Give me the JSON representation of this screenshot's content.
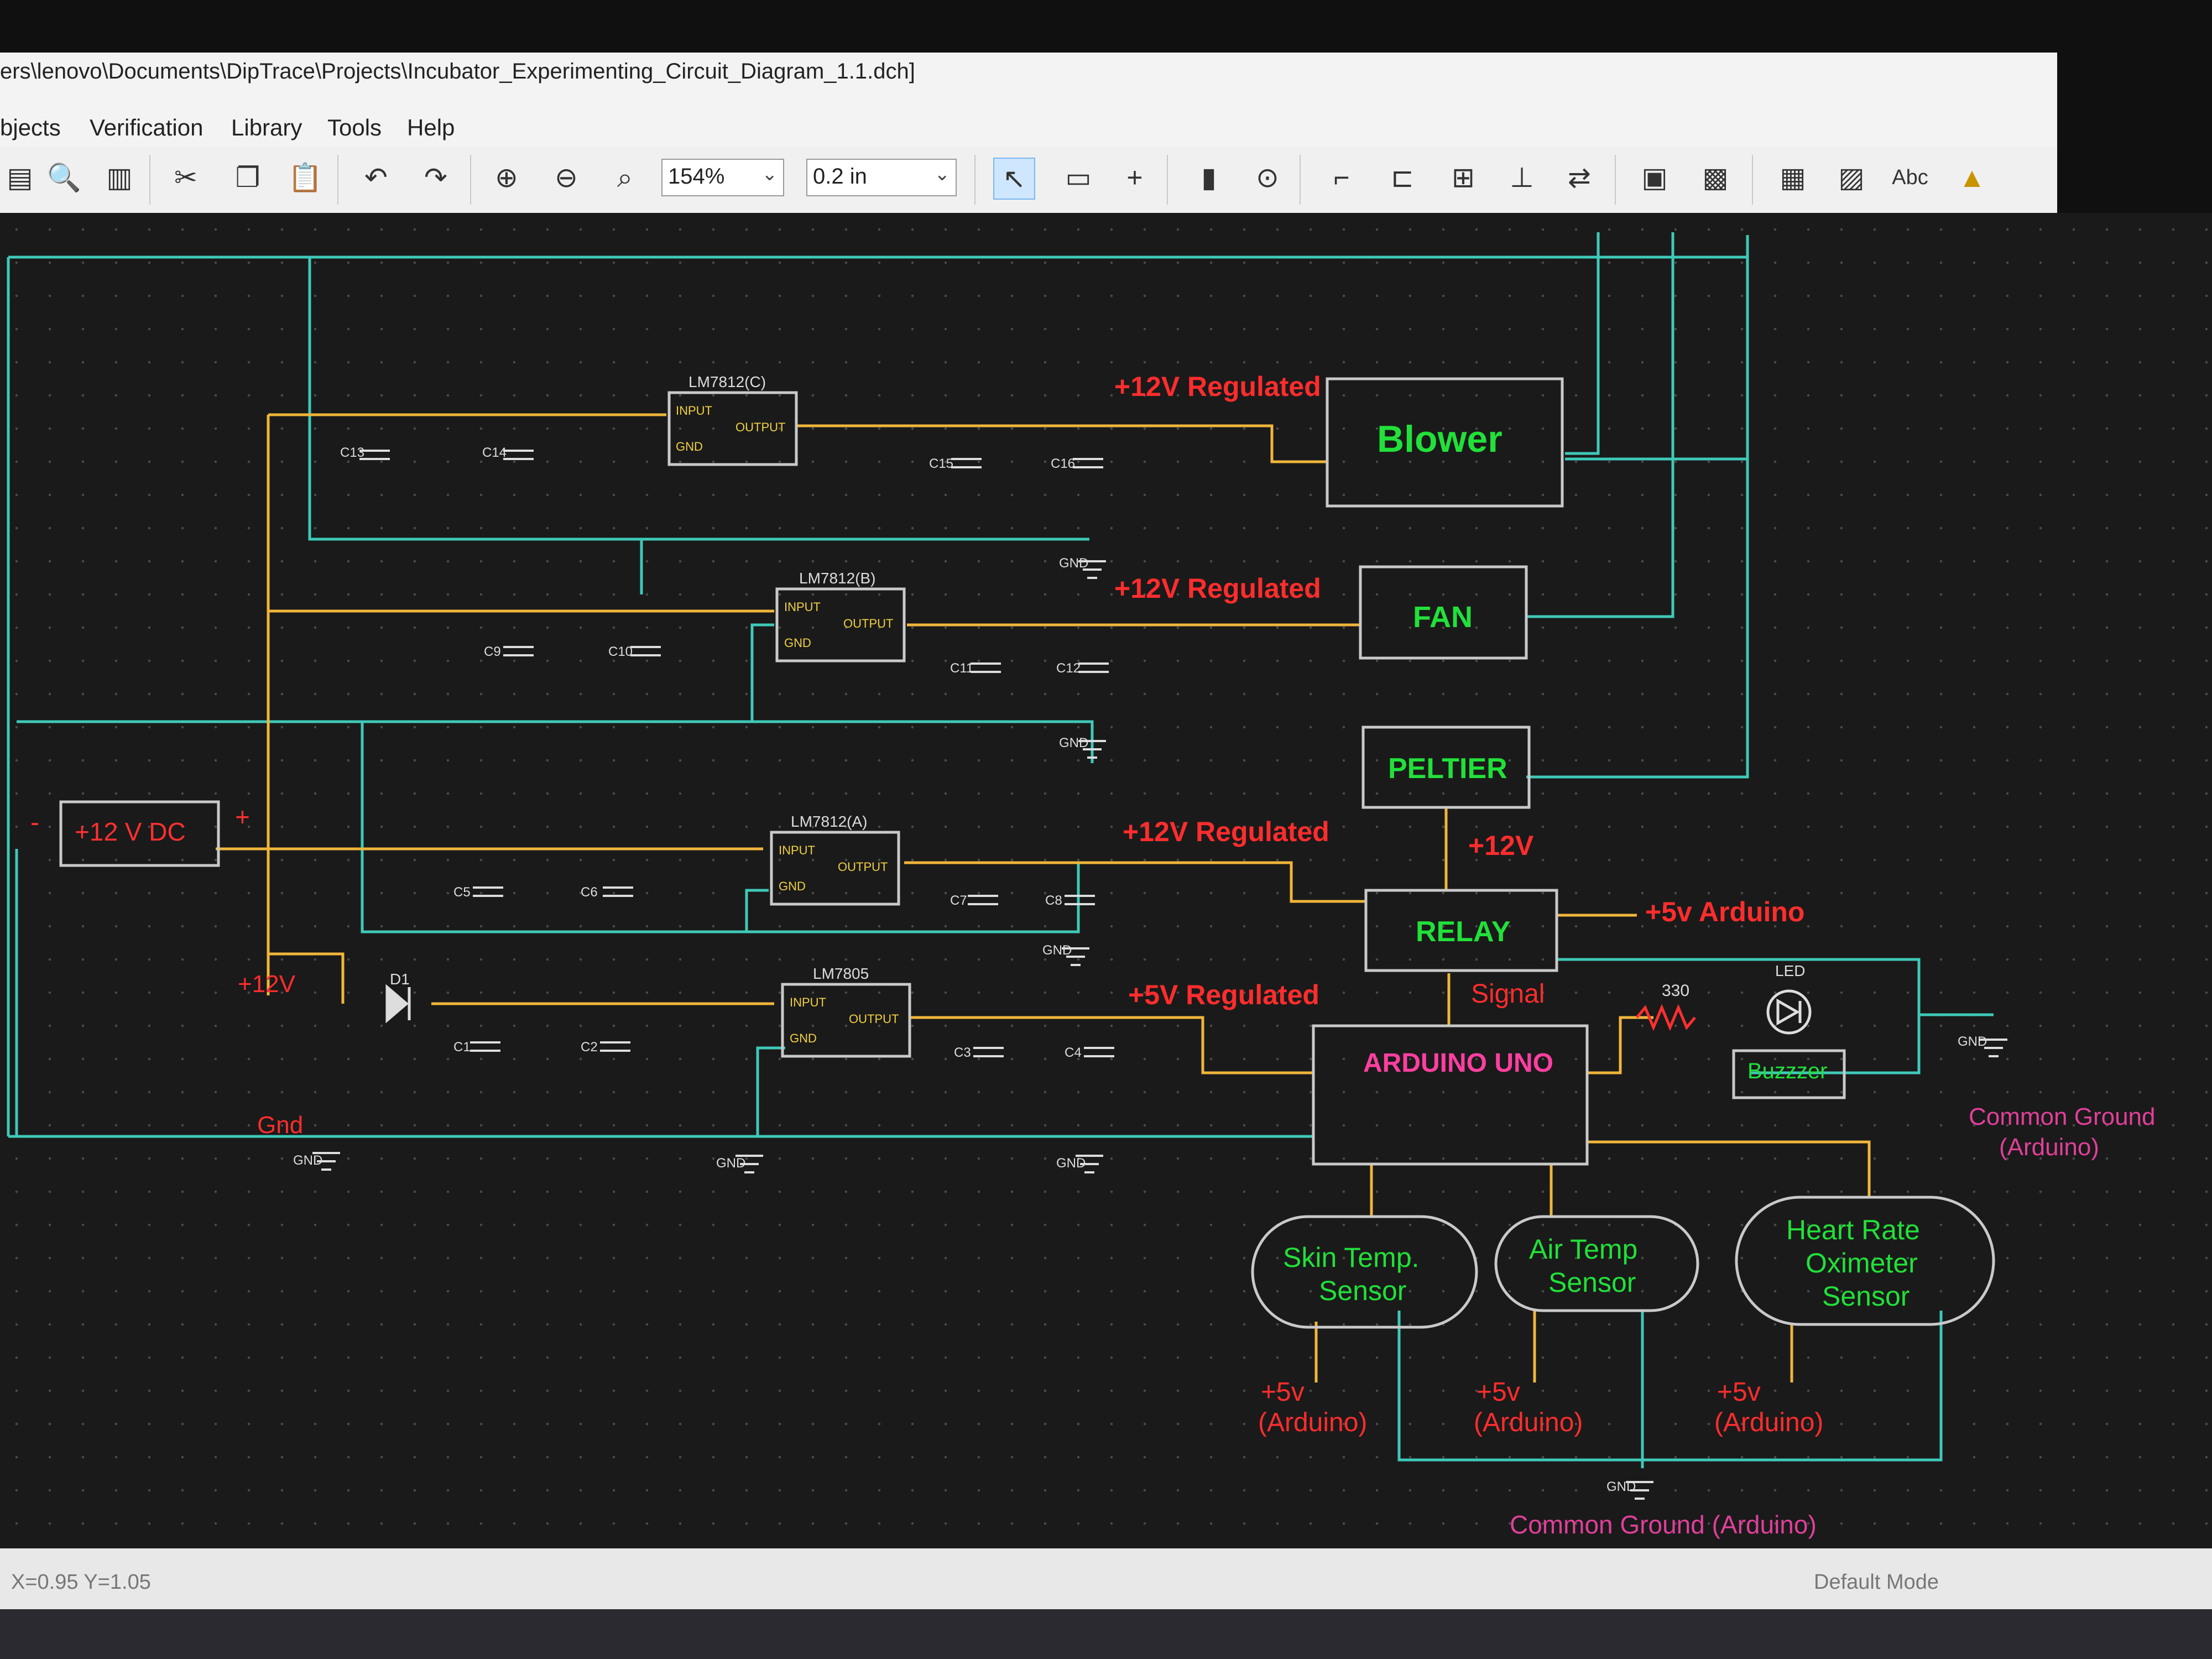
{
  "window": {
    "title": "ers\\lenovo\\Documents\\DipTrace\\Projects\\Incubator_Experimenting_Circuit_Diagram_1.1.dch]"
  },
  "menu": [
    "bjects",
    "Verification",
    "Library",
    "Tools",
    "Help"
  ],
  "toolbar": {
    "zoom": "154%",
    "grid": "0.2 in",
    "text_tool": "Abc"
  },
  "schematic": {
    "power_source": "+12  V  DC",
    "minus": "-",
    "plus": "+",
    "regulators": [
      "LM7812(C)",
      "LM7812(B)",
      "LM7812(A)",
      "LM7805"
    ],
    "pin_input": "INPUT",
    "pin_output": "OUTPUT",
    "pin_gnd": "GND",
    "caps": [
      "C13",
      "C14",
      "C15",
      "C16",
      "C9",
      "C10",
      "C11",
      "C12",
      "C5",
      "C6",
      "C7",
      "C8",
      "C1",
      "C2",
      "C3",
      "C4"
    ],
    "nets": {
      "reg12_1": "+12V  Regulated",
      "reg12_2": "+12V  Regulated",
      "reg12_3": "+12V  Regulated",
      "reg5": "+5V  Regulated",
      "v12_relay": "+12V",
      "v12_diode": "+12V",
      "arduino_5v": "+5v  Arduino",
      "signal": "Signal",
      "gnd": "Gnd"
    },
    "blocks": {
      "blower": "Blower",
      "fan": "FAN",
      "peltier": "PELTIER",
      "relay": "RELAY",
      "arduino": "ARDUINO  UNO",
      "buzzer": "Buzzzer",
      "led": "LED",
      "resistor": "330",
      "diode": "D1"
    },
    "sensors": {
      "skin_1": "Skin  Temp.",
      "skin_2": "Sensor",
      "air_1": "Air  Temp",
      "air_2": "Sensor",
      "heart_1": "Heart  Rate",
      "heart_2": "Oximeter",
      "heart_3": "Sensor"
    },
    "supply_1": "+5v",
    "supply_2": "(Arduino)",
    "common_ground_1": "Common  Ground",
    "common_ground_2": "(Arduino)",
    "common_ground_bottom": "Common  Ground  (Arduino)",
    "gnd_symbol": "GND"
  },
  "status": {
    "coords": "X=0.95  Y=1.05",
    "mode": "Default Mode"
  },
  "colors": {
    "wire_power": "#f0b53a",
    "wire_ground": "#3fc9b8",
    "net_label": "#ff2d2d",
    "block_text": "#22e03a",
    "arduino_text": "#ff3fa0",
    "ground_text": "#e0409a"
  }
}
